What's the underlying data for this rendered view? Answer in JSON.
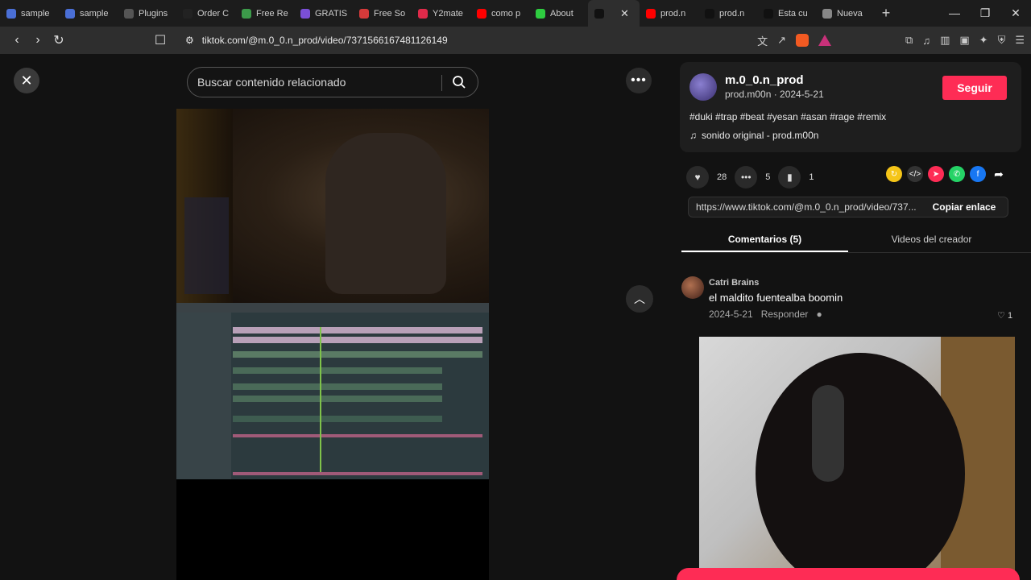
{
  "browser": {
    "tabs": [
      {
        "label": "sample",
        "color": "#4a6fd6"
      },
      {
        "label": "sample",
        "color": "#4a6fd6"
      },
      {
        "label": "Plugins",
        "color": "#555555"
      },
      {
        "label": "Order C",
        "color": "#222222"
      },
      {
        "label": "Free Re",
        "color": "#3c9a4a"
      },
      {
        "label": "GRATIS",
        "color": "#7a4fd6"
      },
      {
        "label": "Free So",
        "color": "#d63a3a"
      },
      {
        "label": "Y2mate",
        "color": "#e02a4a"
      },
      {
        "label": "como p",
        "color": "#ff0000"
      },
      {
        "label": "About",
        "color": "#2ecc40"
      },
      {
        "label": "",
        "color": "#111111",
        "active": true
      },
      {
        "label": "prod.n",
        "color": "#ff0000"
      },
      {
        "label": "prod.n",
        "color": "#111111"
      },
      {
        "label": "Esta cu",
        "color": "#111111"
      },
      {
        "label": "Nueva",
        "color": "#888888"
      }
    ],
    "url": "tiktok.com/@m.0_0.n_prod/video/7371566167481126149"
  },
  "search": {
    "placeholder": "Buscar contenido relacionado"
  },
  "post": {
    "username": "m.0_0.n_prod",
    "subline": "prod.m00n · 2024-5-21",
    "follow_label": "Seguir",
    "hashtags": "#duki #trap #beat #yesan #asan #rage #remix",
    "sound": "sonido original - prod.m00n",
    "likes": "28",
    "comments": "5",
    "saves": "1",
    "link": "https://www.tiktok.com/@m.0_0.n_prod/video/737...",
    "copy_label": "Copiar enlace"
  },
  "tabs": {
    "comments": "Comentarios (5)",
    "creator": "Videos del creador"
  },
  "comment": {
    "author": "Catri Brains",
    "text": "el maldito fuentealba boomin",
    "date": "2024-5-21",
    "reply": "Responder",
    "likes": "1"
  }
}
